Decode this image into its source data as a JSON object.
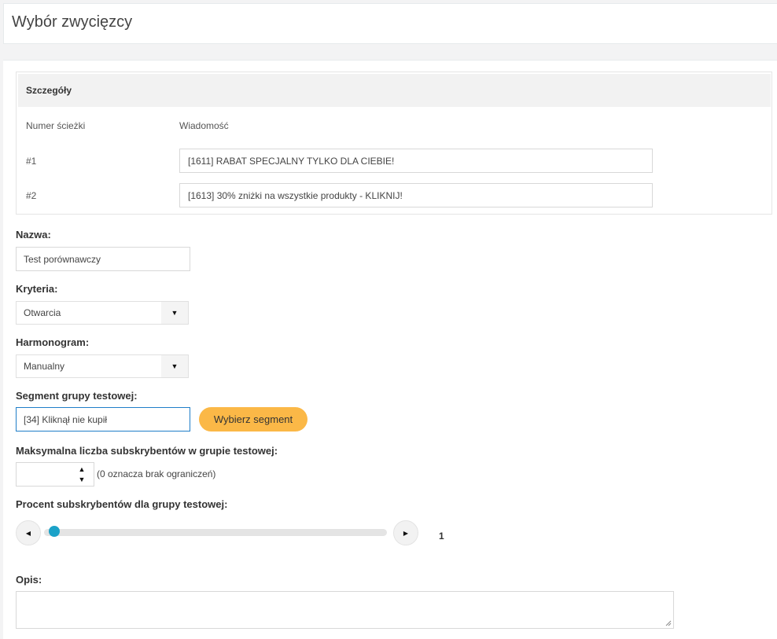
{
  "page": {
    "title": "Wybór zwycięzcy"
  },
  "details": {
    "heading": "Szczegóły",
    "col_track": "Numer ścieżki",
    "col_message": "Wiadomość",
    "rows": [
      {
        "track": "#1",
        "message": "[1611] RABAT SPECJALNY TYLKO DLA CIEBIE!"
      },
      {
        "track": "#2",
        "message": "[1613] 30% zniżki na wszystkie produkty - KLIKNIJ!"
      }
    ]
  },
  "form": {
    "name_label": "Nazwa:",
    "name_value": "Test porównawczy",
    "criteria_label": "Kryteria:",
    "criteria_value": "Otwarcia",
    "schedule_label": "Harmonogram:",
    "schedule_value": "Manualny",
    "segment_label": "Segment grupy testowej:",
    "segment_value": "[34] Kliknął nie kupił",
    "segment_button": "Wybierz segment",
    "max_label": "Maksymalna liczba subskrybentów w grupie testowej:",
    "max_value": "",
    "max_hint": "(0 oznacza brak ograniczeń)",
    "percent_label": "Procent subskrybentów dla grupy testowej:",
    "percent_value": "1",
    "percent_fraction": 0.01,
    "description_label": "Opis:",
    "description_value": ""
  },
  "icons": {
    "dropdown": "triangle-down",
    "spinner_up": "triangle-up",
    "spinner_down": "triangle-down",
    "slider_prev": "triangle-left",
    "slider_next": "triangle-right"
  },
  "colors": {
    "accent_button": "#fbb847",
    "slider_thumb": "#1ba2c8",
    "focus_border": "#1f7ec8"
  }
}
